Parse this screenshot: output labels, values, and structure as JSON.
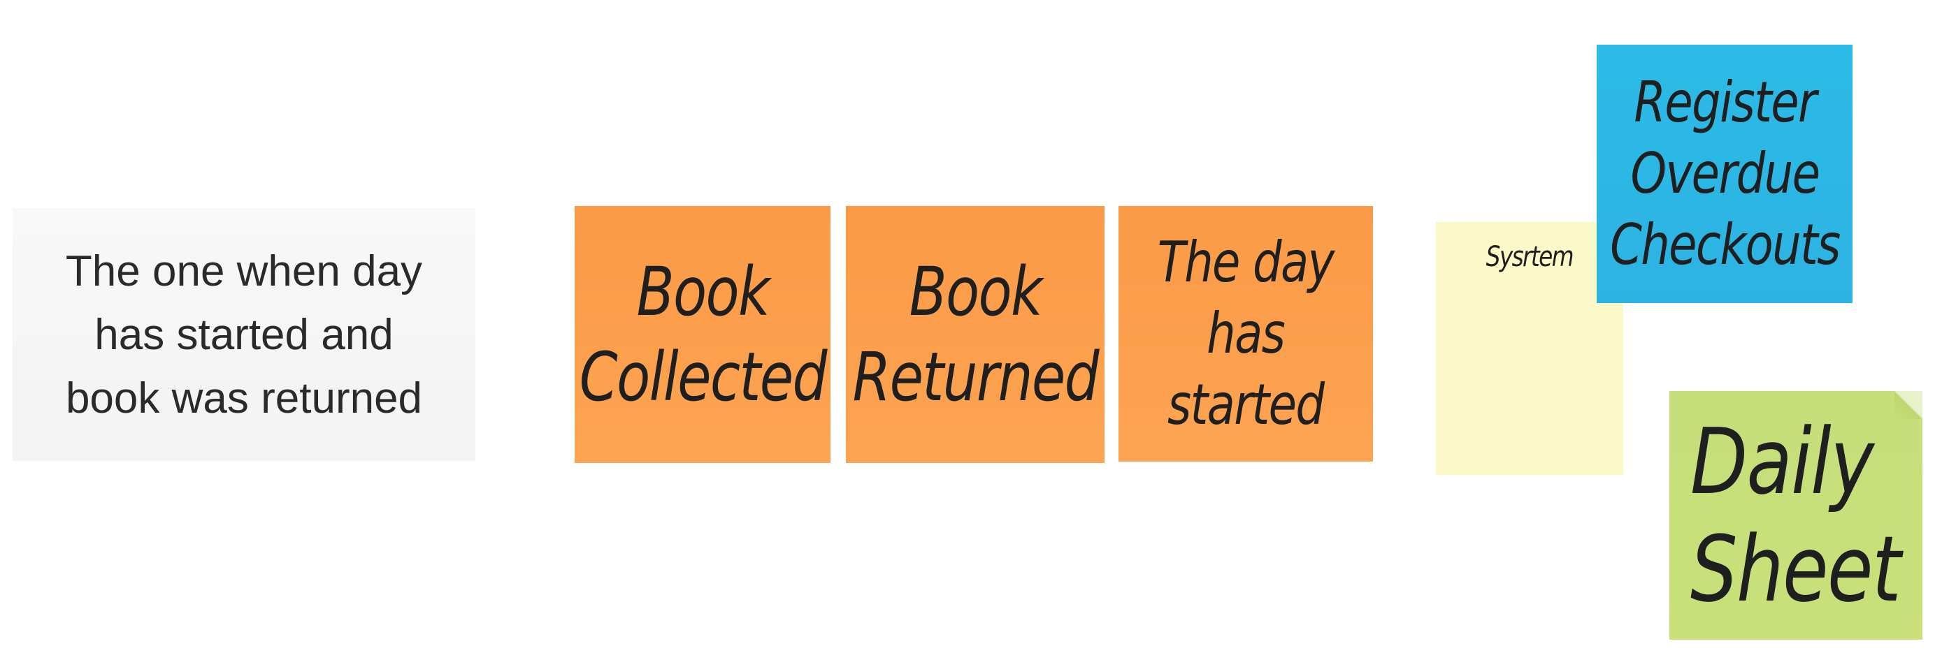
{
  "notes": {
    "white": {
      "lines": [
        "The one when day",
        "has started and",
        "book was returned"
      ]
    },
    "collected": {
      "lines": [
        "Book",
        "Collected"
      ]
    },
    "returned": {
      "lines": [
        "Book",
        "Returned"
      ]
    },
    "day_started": {
      "lines": [
        "The day",
        "has",
        "started"
      ]
    },
    "system": {
      "lines": [
        "Sysrtem"
      ]
    },
    "register": {
      "lines": [
        "Register",
        "Overdue",
        "Checkouts"
      ]
    },
    "daily_sheet": {
      "lines": [
        "Daily",
        "Sheet"
      ]
    }
  },
  "colors": {
    "orange": "#fb9a46",
    "blue": "#2cbbe6",
    "yellow": "#fbf9c7",
    "green": "#c6df7a",
    "white": "#f6f6f6"
  }
}
